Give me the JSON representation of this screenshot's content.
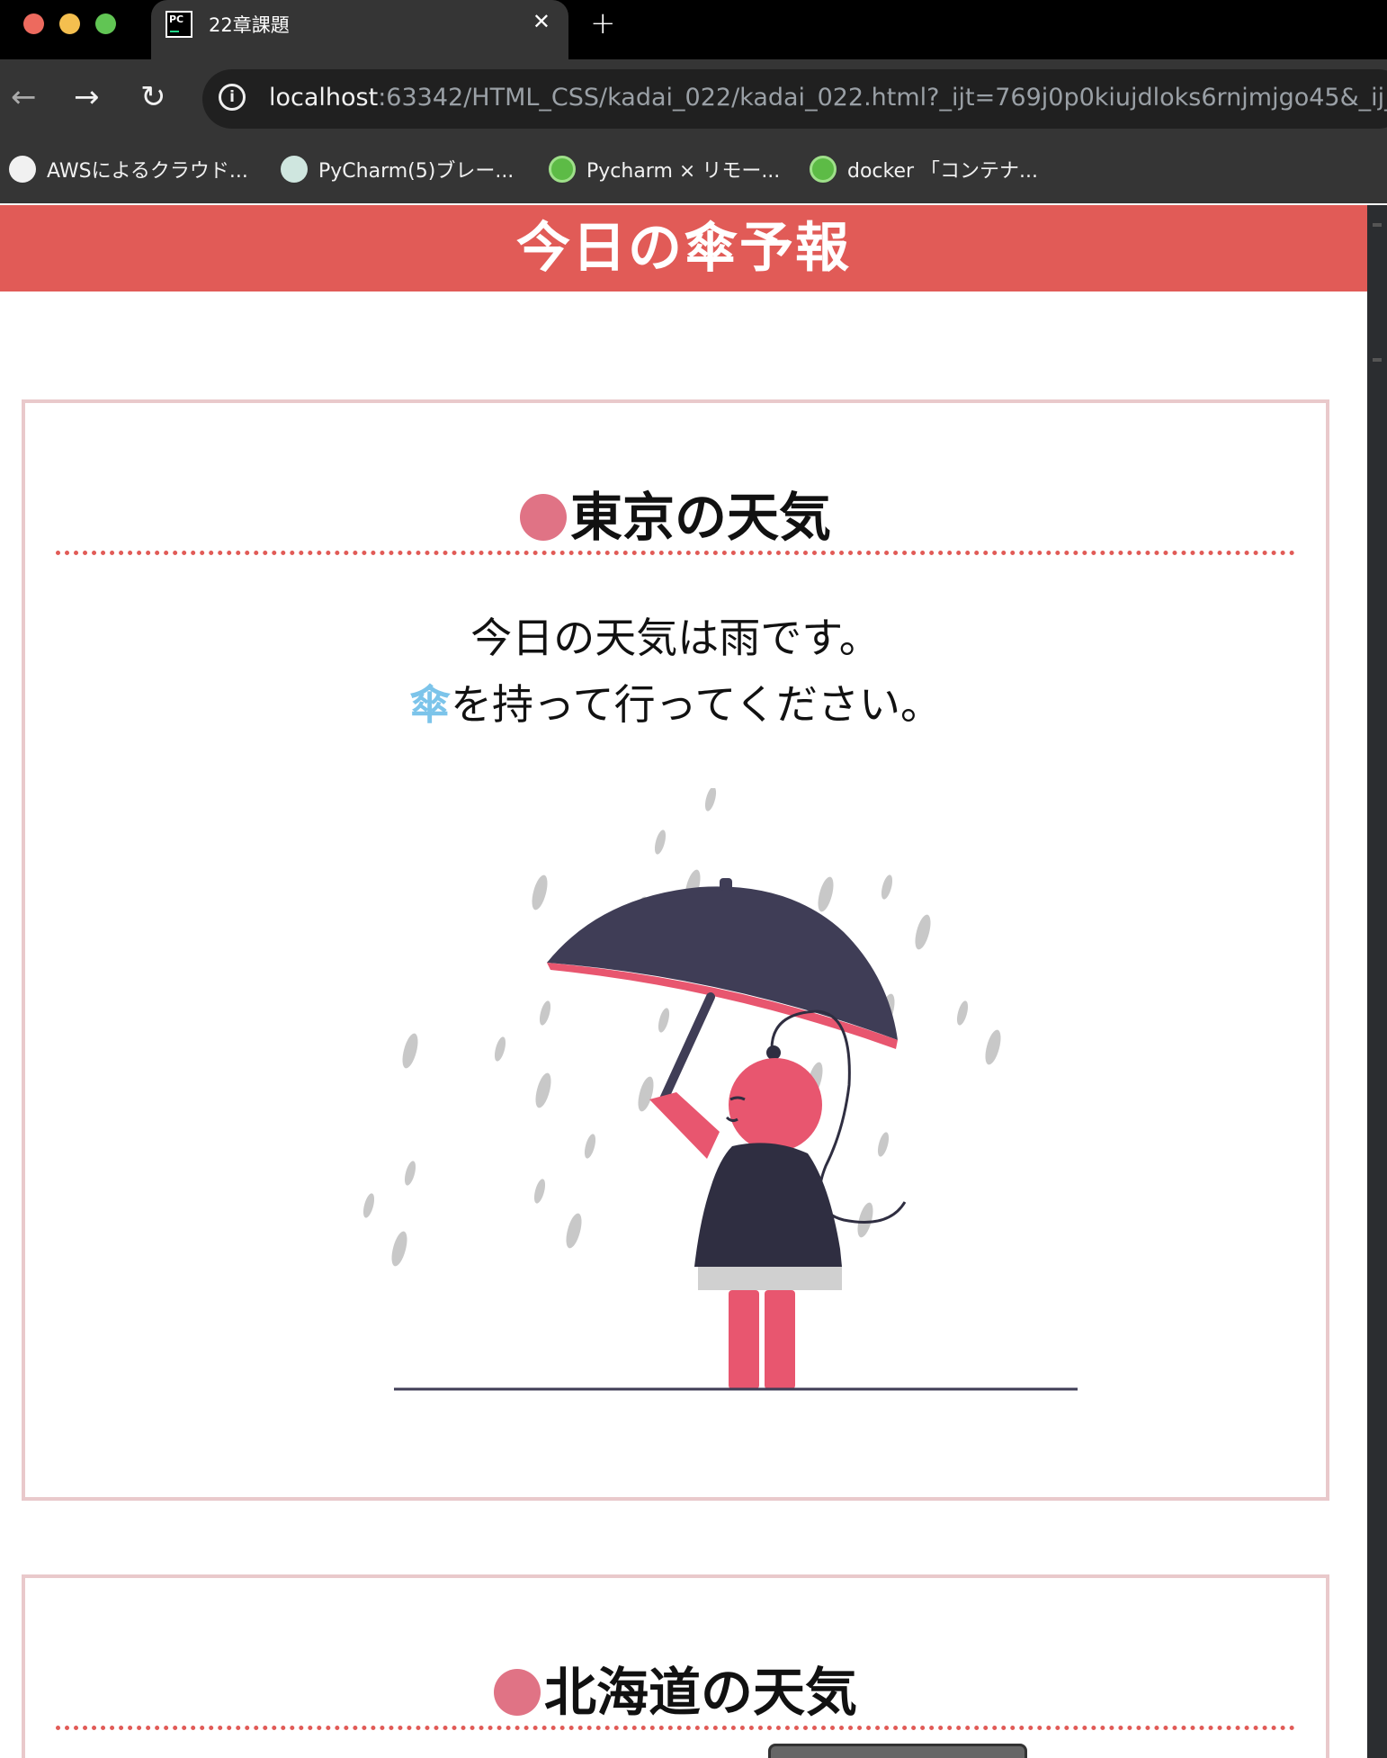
{
  "browser": {
    "tab_title": "22章課題",
    "tab_favicon_text": "PC",
    "url_host": "localhost",
    "url_rest": ":63342/HTML_CSS/kadai_022/kadai_022.html?_ijt=769j0p0kiujdloks6rnjmjgo45&_ij_",
    "bookmarks": [
      {
        "label": "AWSによるクラウド...",
        "icon": "globe-icon"
      },
      {
        "label": "PyCharm(5)ブレー...",
        "icon": "pycharm-site-icon"
      },
      {
        "label": "Pycharm × リモー...",
        "icon": "green-ring-icon"
      },
      {
        "label": "docker 「コンテナ...",
        "icon": "green-ring-icon"
      }
    ]
  },
  "page": {
    "header_title": "今日の傘予報",
    "sections": [
      {
        "title": "東京の天気",
        "line1": "今日の天気は雨です。",
        "line2_highlight": "傘",
        "line2_rest": "を持って行ってください。"
      },
      {
        "title": "北海道の天気"
      }
    ]
  },
  "colors": {
    "header_bg": "#e15b57",
    "card_border": "#e9c9cb",
    "title_dot": "#e07385",
    "highlight": "#7cc4ea",
    "umbrella_dark": "#3f3d56",
    "figure_pink": "#e8566f"
  }
}
